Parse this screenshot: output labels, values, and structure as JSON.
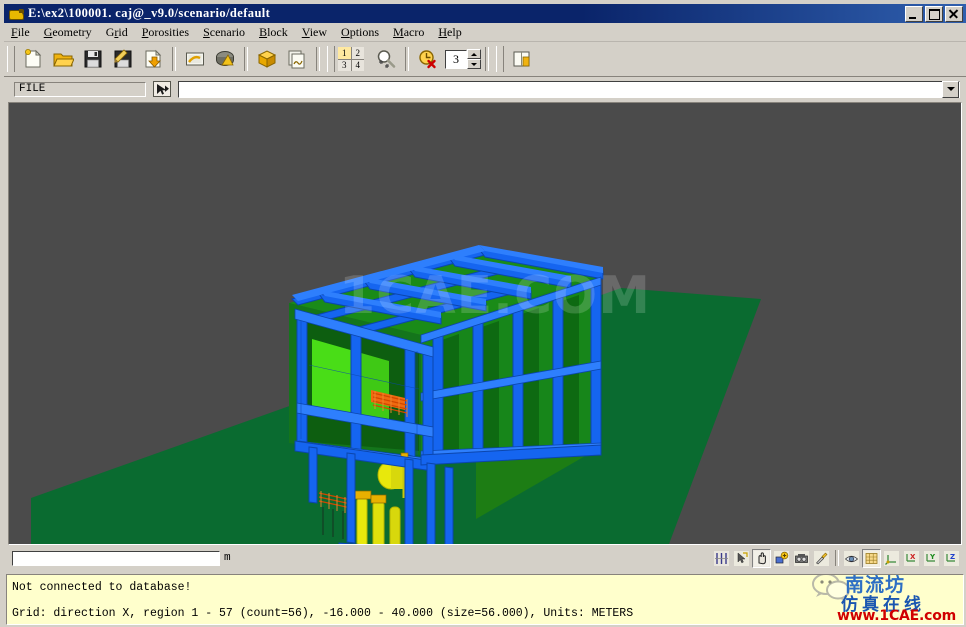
{
  "window": {
    "title": "E:\\ex2\\100001. caj@_v9.0/scenario/default",
    "icon": "app-bird-icon",
    "controls": {
      "minimize": "_",
      "maximize": "□",
      "close": "✕"
    }
  },
  "menubar": {
    "items": [
      {
        "mnemonic": "F",
        "rest": "ile",
        "name": "file"
      },
      {
        "mnemonic": "G",
        "rest": "eometry",
        "name": "geometry"
      },
      {
        "mnemonic": "r",
        "pre": "G",
        "rest": "id",
        "name": "grid"
      },
      {
        "mnemonic": "P",
        "rest": "orosities",
        "name": "porosities"
      },
      {
        "mnemonic": "S",
        "rest": "cenario",
        "name": "scenario"
      },
      {
        "mnemonic": "B",
        "rest": "lock",
        "name": "block"
      },
      {
        "mnemonic": "V",
        "rest": "iew",
        "name": "view"
      },
      {
        "mnemonic": "O",
        "rest": "ptions",
        "name": "options"
      },
      {
        "mnemonic": "M",
        "rest": "acro",
        "name": "macro"
      },
      {
        "mnemonic": "H",
        "rest": "elp",
        "name": "help"
      }
    ]
  },
  "toolbar": {
    "buttons": [
      {
        "name": "new-file-button",
        "icon": "new-document-icon"
      },
      {
        "name": "open-file-button",
        "icon": "open-folder-icon"
      },
      {
        "name": "save-file-button",
        "icon": "floppy-disk-icon"
      },
      {
        "name": "save-as-button",
        "icon": "floppy-pencil-icon"
      },
      {
        "name": "import-button",
        "icon": "document-down-arrow-icon"
      },
      {
        "name": "view-geometry-button",
        "icon": "picture-icon"
      },
      {
        "name": "render-button",
        "icon": "shaded-view-icon"
      },
      {
        "name": "block-button",
        "icon": "yellow-box-icon"
      },
      {
        "name": "report-button",
        "icon": "documents-stack-icon"
      },
      {
        "name": "zoom-fit-button",
        "icon": "magnifier-fit-icon"
      },
      {
        "name": "clear-timing-button",
        "icon": "clock-delete-icon"
      },
      {
        "name": "notes-button",
        "icon": "book-pencil-icon"
      }
    ],
    "viewport_layout": {
      "name": "viewport-layout-selector",
      "cells": [
        "1",
        "2",
        "3",
        "4"
      ],
      "active": "1"
    },
    "viewport_count": {
      "name": "viewport-count-spinner",
      "value": "3"
    }
  },
  "filebar": {
    "label": "FILE",
    "pick_icon": "pick-arrow-icon",
    "combo_value": "",
    "combo_placeholder": ""
  },
  "viewport": {
    "background_color": "#4b4b4b",
    "ground_color": "#0a6b30",
    "frame_color": "#1565f0",
    "panel_color": "#158a18",
    "panel_color_light": "#4cdd17",
    "vessel_color": "#e8e80c",
    "pipe_color": "#f06a10",
    "watermark": "1CAE.COM"
  },
  "viewbar": {
    "distance_value": "",
    "unit_label": "m",
    "tools": [
      {
        "name": "measure-tool-button",
        "icon": "ruler-icon",
        "active": false
      },
      {
        "name": "select-tool-button",
        "icon": "cursor-arrow-icon",
        "active": false
      },
      {
        "name": "pan-tool-button",
        "icon": "hand-icon",
        "active": true
      },
      {
        "name": "add-object-button",
        "icon": "add-object-icon",
        "active": false
      },
      {
        "name": "camera-tool-button",
        "icon": "camera-icon",
        "active": false
      },
      {
        "name": "paint-tool-button",
        "icon": "paintbrush-icon",
        "active": false
      },
      {
        "name": "visibility-button",
        "icon": "eye-icon",
        "active": false
      },
      {
        "name": "grid-toggle-button",
        "icon": "grid-icon",
        "active": true
      },
      {
        "name": "iso-view-button",
        "icon": "axes-iso-icon",
        "active": false
      },
      {
        "name": "x-view-button",
        "icon": "axis-x-icon",
        "active": false
      },
      {
        "name": "y-view-button",
        "icon": "axis-y-icon",
        "active": false
      },
      {
        "name": "z-view-button",
        "icon": "axis-z-icon",
        "active": false
      }
    ]
  },
  "status": {
    "line1": "Not connected to database!",
    "line2": "Grid: direction X, region 1 - 57 (count=56), -16.000 - 40.000 (size=56.000), Units: METERS"
  },
  "watermark": {
    "wechat_icon": "wechat-logo-icon",
    "brand_cn": "南流坊",
    "tagline_cn": "仿真在线",
    "url": "www.1CAE.com"
  }
}
